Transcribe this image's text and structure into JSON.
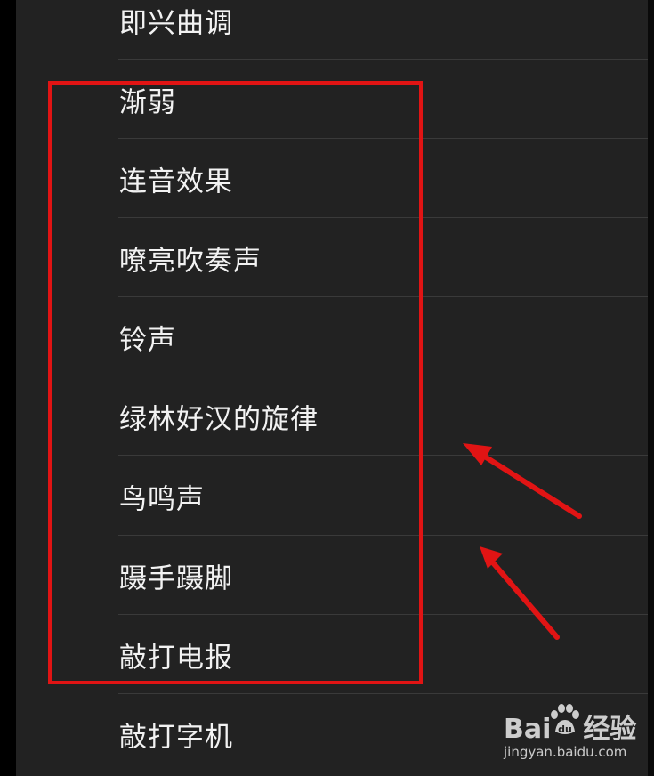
{
  "menu": {
    "items": [
      {
        "label": "即兴曲调"
      },
      {
        "label": "渐弱"
      },
      {
        "label": "连音效果"
      },
      {
        "label": "嘹亮吹奏声"
      },
      {
        "label": "铃声"
      },
      {
        "label": "绿林好汉的旋律"
      },
      {
        "label": "鸟鸣声"
      },
      {
        "label": "蹑手蹑脚"
      },
      {
        "label": "敲打电报"
      },
      {
        "label": "敲打字机"
      }
    ]
  },
  "annotation": {
    "box_color": "#e11414",
    "arrow_color": "#e11414"
  },
  "watermark": {
    "brand_left": "Bai",
    "brand_right": "经验",
    "url": "jingyan.baidu.com"
  },
  "colors": {
    "background": "#222222",
    "text": "#f2f2f2",
    "divider": "#3a3a3a"
  }
}
